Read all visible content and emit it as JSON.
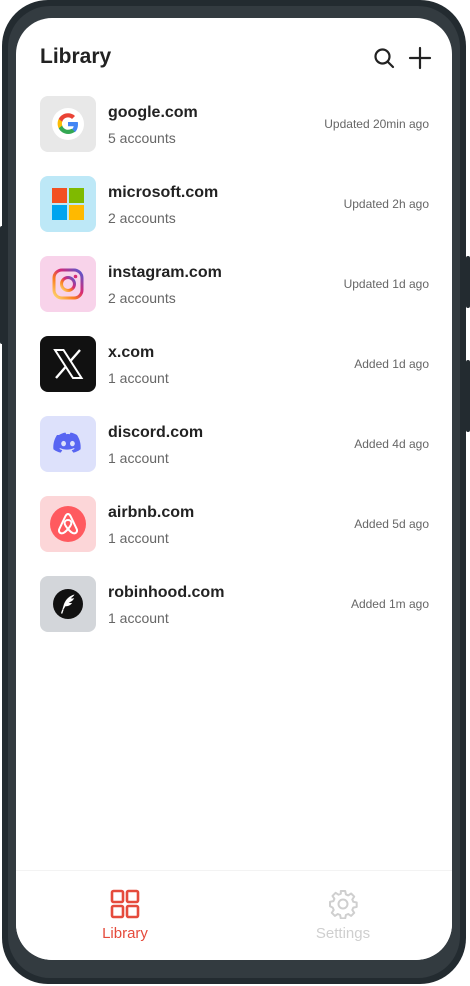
{
  "header": {
    "title": "Library"
  },
  "items": [
    {
      "domain": "google.com",
      "count": "5 accounts",
      "meta": "Updated 20min ago",
      "icon": "google-icon",
      "tile_color": "#e8e8e8"
    },
    {
      "domain": "microsoft.com",
      "count": "2 accounts",
      "meta": "Updated 2h ago",
      "icon": "microsoft-icon",
      "tile_color": "#bde8f7"
    },
    {
      "domain": "instagram.com",
      "count": "2 accounts",
      "meta": "Updated 1d ago",
      "icon": "instagram-icon",
      "tile_color": "#f8d3ea"
    },
    {
      "domain": "x.com",
      "count": "1 account",
      "meta": "Added 1d ago",
      "icon": "x-icon",
      "tile_color": "#111111"
    },
    {
      "domain": "discord.com",
      "count": "1 account",
      "meta": "Added 4d ago",
      "icon": "discord-icon",
      "tile_color": "#dde1fb"
    },
    {
      "domain": "airbnb.com",
      "count": "1 account",
      "meta": "Added 5d ago",
      "icon": "airbnb-icon",
      "tile_color": "#fcd6d8"
    },
    {
      "domain": "robinhood.com",
      "count": "1 account",
      "meta": "Added 1m ago",
      "icon": "robinhood-icon",
      "tile_color": "#d3d6da"
    }
  ],
  "tabs": [
    {
      "label": "Library",
      "icon": "grid-icon",
      "active": true,
      "color": "#e54b3c"
    },
    {
      "label": "Settings",
      "icon": "gear-icon",
      "active": false,
      "color": "#cfcfcf"
    }
  ],
  "colors": {
    "accent": "#e54b3c",
    "inactive": "#cfcfcf"
  }
}
